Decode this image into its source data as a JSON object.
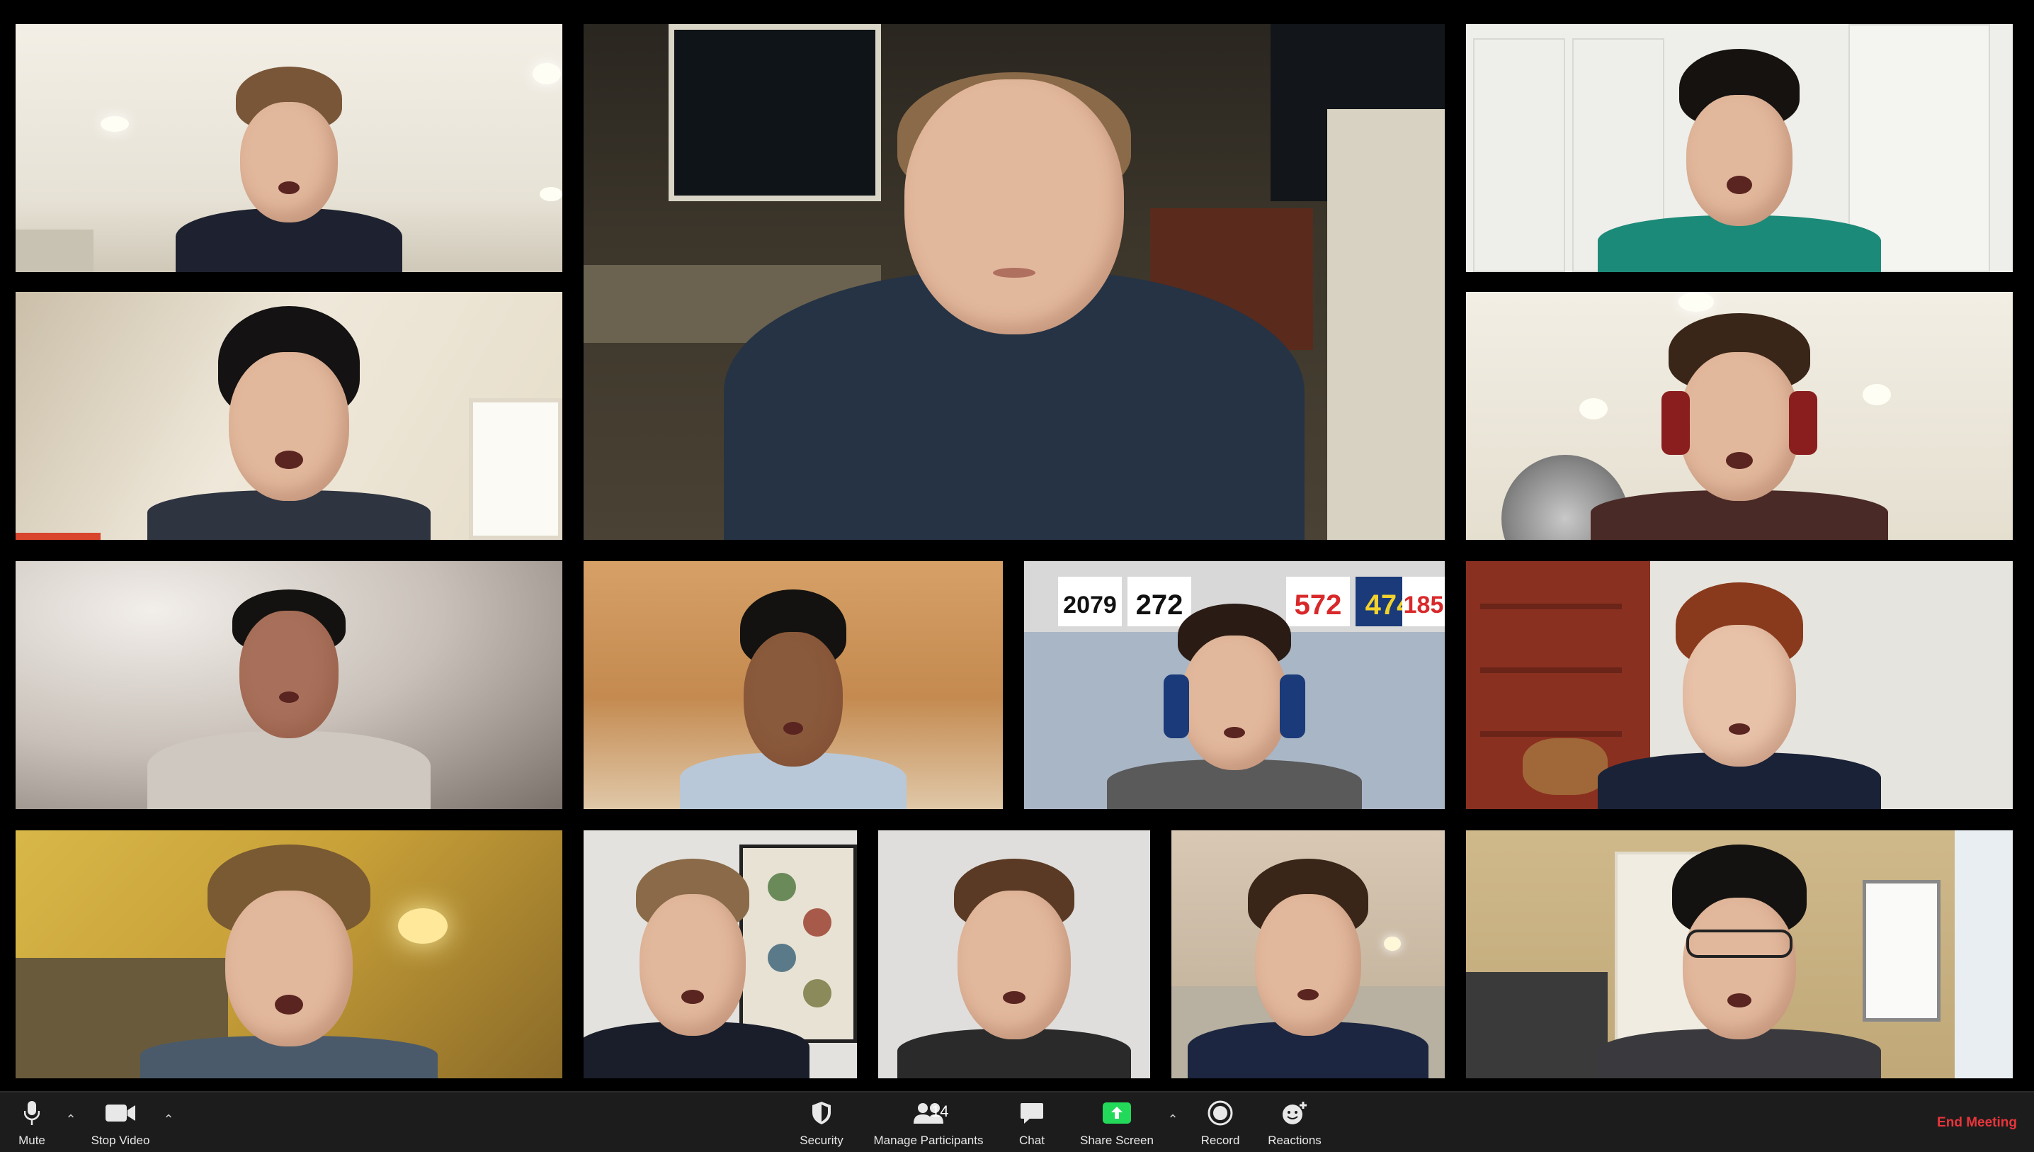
{
  "toolbar": {
    "mute": "Mute",
    "stop_video": "Stop Video",
    "security": "Security",
    "manage_participants": "Manage Participants",
    "participant_count": "14",
    "chat": "Chat",
    "share_screen": "Share Screen",
    "record": "Record",
    "reactions": "Reactions",
    "end_meeting": "End Meeting"
  },
  "colors": {
    "toolbar_bg": "#1c1c1c",
    "end_meeting": "#e8353b",
    "share_screen": "#23d959"
  },
  "bib_numbers": [
    "2079",
    "272",
    "572",
    "474",
    "185"
  ],
  "participants": [
    {
      "id": "p1"
    },
    {
      "id": "p2"
    },
    {
      "id": "p3"
    },
    {
      "id": "p4"
    },
    {
      "id": "p5"
    },
    {
      "id": "p6"
    },
    {
      "id": "p7"
    },
    {
      "id": "p8"
    },
    {
      "id": "p9"
    },
    {
      "id": "p10"
    },
    {
      "id": "p11"
    },
    {
      "id": "p12"
    },
    {
      "id": "p13"
    },
    {
      "id": "p14"
    }
  ]
}
